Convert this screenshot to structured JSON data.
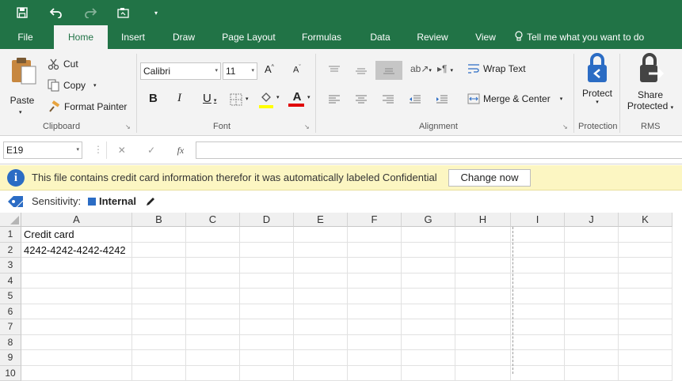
{
  "colors": {
    "brand": "#217346",
    "ribbon": "#f3f3f3",
    "message_bar": "#fcf6c2",
    "sensitivity_square": "#2b6cc4",
    "underline_yellow": "#ffff00",
    "underline_red": "#e00000"
  },
  "qat": {
    "icons": [
      "save-icon",
      "undo-icon",
      "redo-icon",
      "touch-mode-icon",
      "customize-qat-icon"
    ]
  },
  "tabs": [
    "File",
    "Home",
    "Insert",
    "Draw",
    "Page Layout",
    "Formulas",
    "Data",
    "Review",
    "View"
  ],
  "tell_me": "Tell me what you want to do",
  "clipboard": {
    "paste": "Paste",
    "cut": "Cut",
    "copy": "Copy",
    "format_painter": "Format Painter",
    "label": "Clipboard"
  },
  "font": {
    "name": "Calibri",
    "size": "11",
    "bold": "B",
    "italic": "I",
    "underline": "U",
    "grow": "A",
    "shrink": "A",
    "color": "A",
    "label": "Font"
  },
  "alignment": {
    "wrap_text": "Wrap Text",
    "merge_center": "Merge & Center",
    "label": "Alignment"
  },
  "protection": {
    "protect": "Protect",
    "label": "Protection"
  },
  "rms": {
    "share_protected_1": "Share",
    "share_protected_2": "Protected",
    "label": "RMS"
  },
  "formula_bar": {
    "name_box": "E19",
    "cancel": "✕",
    "enter": "✓",
    "fx": "fx",
    "value": ""
  },
  "message": {
    "text": "This file contains credit card information therefor it was automatically labeled Confidential",
    "button": "Change now"
  },
  "sensitivity": {
    "label": "Sensitivity:",
    "value": "Internal"
  },
  "sheet": {
    "columns": [
      "A",
      "B",
      "C",
      "D",
      "E",
      "F",
      "G",
      "H",
      "I",
      "J",
      "K"
    ],
    "rows": [
      "1",
      "2",
      "3",
      "4",
      "5",
      "6",
      "7",
      "8",
      "9",
      "10"
    ],
    "cells": {
      "A1": "Credit card",
      "A2": "4242-4242-4242-4242"
    }
  }
}
